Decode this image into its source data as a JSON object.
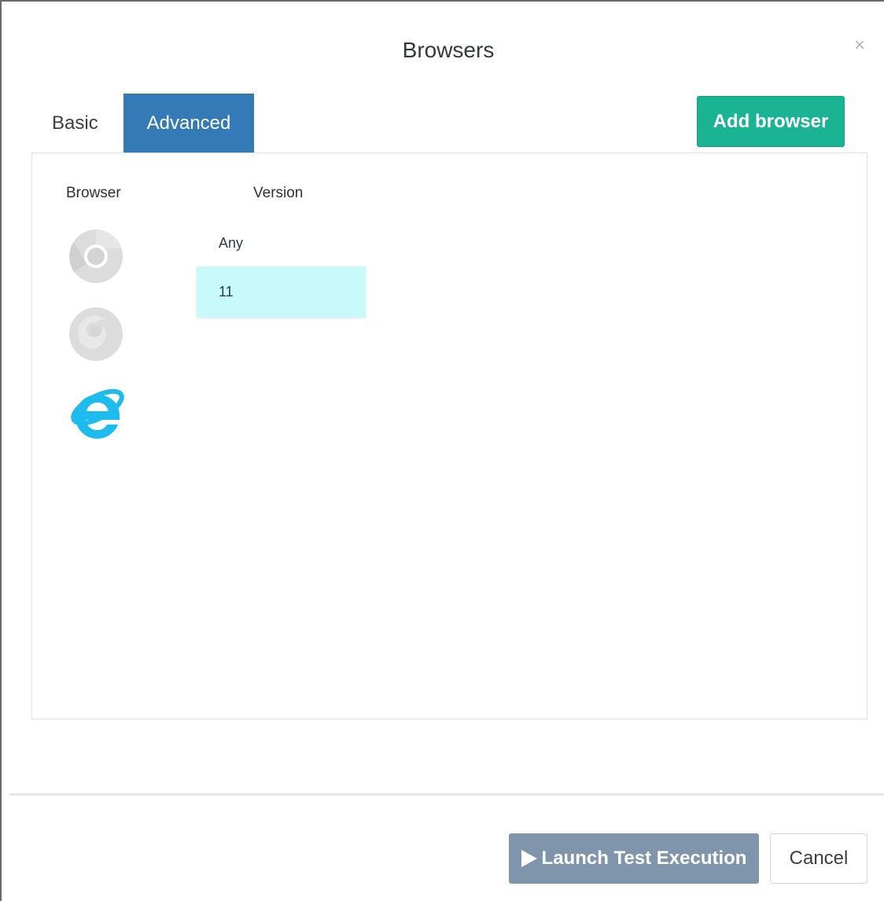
{
  "dialog": {
    "title": "Browsers",
    "close_glyph": "×"
  },
  "tabs": [
    {
      "label": "Basic",
      "active": false
    },
    {
      "label": "Advanced",
      "active": true
    }
  ],
  "toolbar": {
    "add_browser_label": "Add browser"
  },
  "table": {
    "headers": {
      "browser": "Browser",
      "version": "Version"
    },
    "browsers": [
      {
        "icon": "chrome-icon",
        "state": "disabled"
      },
      {
        "icon": "firefox-icon",
        "state": "disabled"
      },
      {
        "icon": "internet-explorer-icon",
        "state": "selected"
      }
    ],
    "versions": [
      {
        "label": "Any",
        "selected": false
      },
      {
        "label": "11",
        "selected": true
      }
    ]
  },
  "footer": {
    "launch_label": "Launch Test Execution",
    "cancel_label": "Cancel"
  },
  "colors": {
    "active_tab": "#337ab7",
    "add_button": "#1ab394",
    "launch_button": "#7f95ab",
    "selected_version": "#c9fafb",
    "ie_blue": "#1ebbee",
    "inactive_icon": "#d9d9d9"
  }
}
